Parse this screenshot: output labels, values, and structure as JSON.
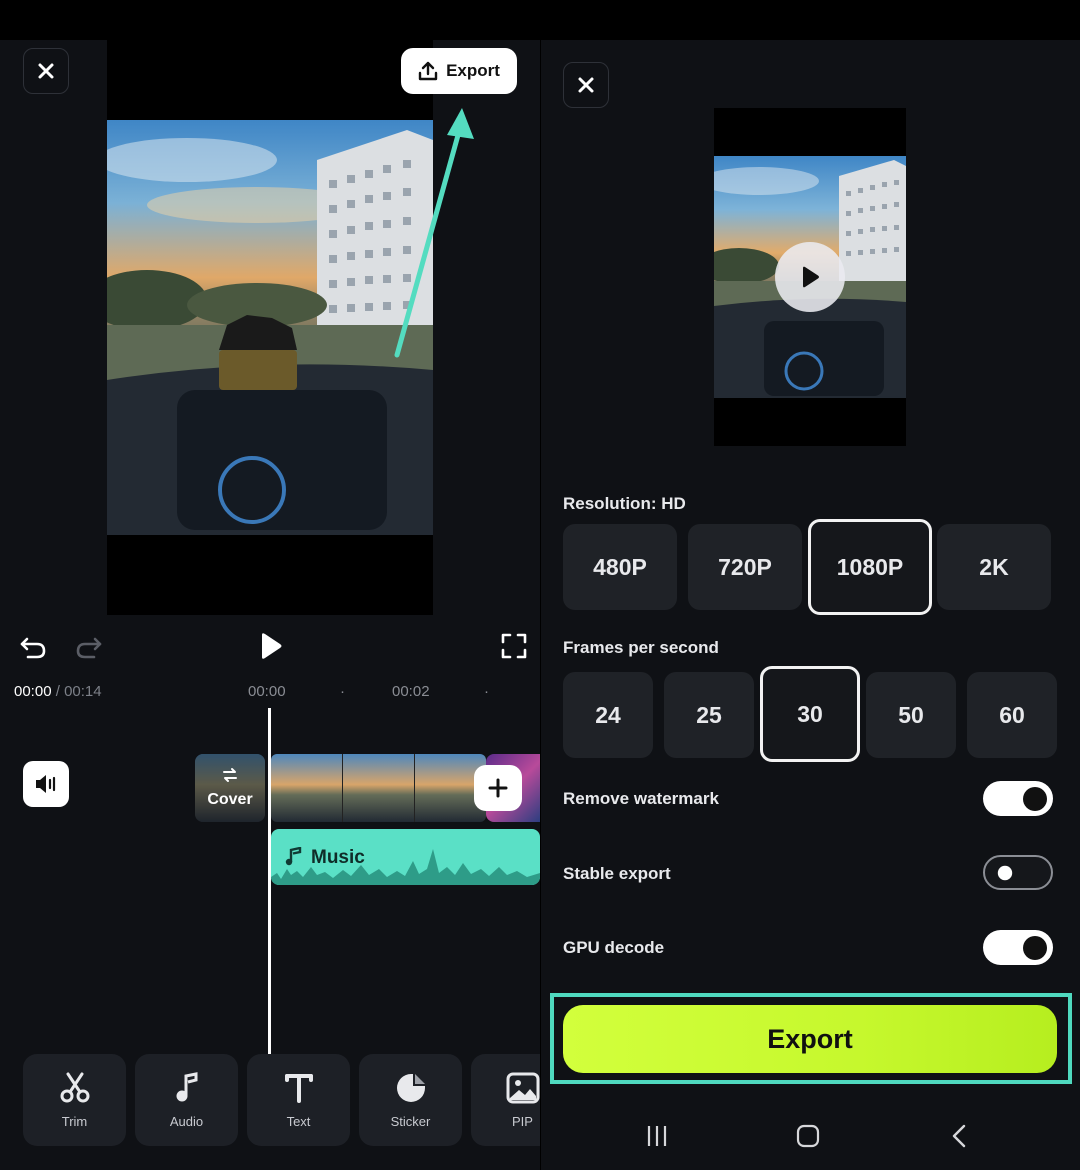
{
  "editor": {
    "export_label": "Export",
    "time_current": "00:00",
    "time_separator": " / ",
    "time_total": "00:14",
    "ruler_marks": [
      "00:00",
      "00:02"
    ],
    "cover_label": "Cover",
    "music_label": "Music",
    "tools": [
      {
        "label": "Trim",
        "icon": "scissors-icon"
      },
      {
        "label": "Audio",
        "icon": "music-note-icon"
      },
      {
        "label": "Text",
        "icon": "text-icon"
      },
      {
        "label": "Sticker",
        "icon": "sticker-icon"
      },
      {
        "label": "PIP",
        "icon": "image-icon"
      }
    ]
  },
  "export_panel": {
    "resolution_label": "Resolution: HD",
    "resolutions": [
      "480P",
      "720P",
      "1080P",
      "2K"
    ],
    "selected_resolution": "1080P",
    "fps_label": "Frames per second",
    "fps_options": [
      "24",
      "25",
      "30",
      "50",
      "60"
    ],
    "selected_fps": "30",
    "toggles": [
      {
        "label": "Remove watermark",
        "on": true
      },
      {
        "label": "Stable export",
        "on": false
      },
      {
        "label": "GPU decode",
        "on": true
      }
    ],
    "export_button": "Export"
  },
  "colors": {
    "accent_lime": "#c6f82d",
    "highlight_teal": "#4fd9bf",
    "music_track": "#5ae0c6",
    "panel_bg": "#0f1115"
  }
}
